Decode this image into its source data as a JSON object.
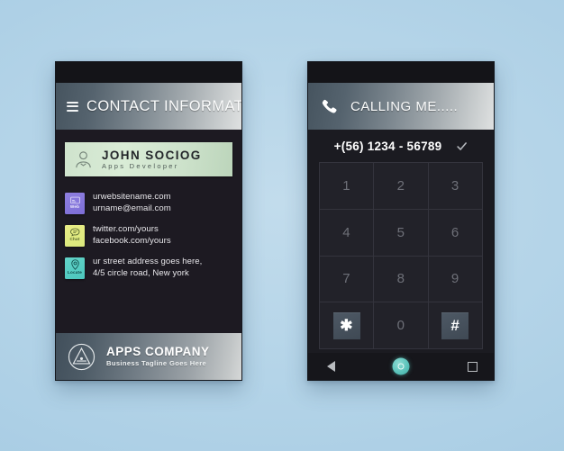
{
  "background_color": "#b4d4e8",
  "left_phone": {
    "name": "contact-information-screen",
    "header": {
      "menu_icon": "hamburger-icon",
      "title": "CONTACT INFORMATION"
    },
    "namecard": {
      "icon": "person-avatar-icon",
      "name": "JOHN SOCIOG",
      "role": "Apps Developer",
      "background_color": "#d4e8d1"
    },
    "contacts": [
      {
        "icon": "web-icon",
        "icon_caption": "Web",
        "icon_color": "#8376dc",
        "lines": [
          "urwebsitename.com",
          "urname@email.com"
        ]
      },
      {
        "icon": "chat-icon",
        "icon_caption": "Chat",
        "icon_color": "#e2ea80",
        "lines": [
          "twitter.com/yours",
          "facebook.com/yours"
        ]
      },
      {
        "icon": "locate-icon",
        "icon_caption": "Locate",
        "icon_color": "#55cbc2",
        "lines": [
          "ur street address goes here,",
          "4/5 circle road, New york"
        ]
      }
    ],
    "footer": {
      "logo_icon": "apps-company-logo-icon",
      "title": "APPS COMPANY",
      "tagline": "Business Tagline Goes Here"
    }
  },
  "right_phone": {
    "name": "dialer-calling-screen",
    "header": {
      "phone_icon": "phone-handset-icon",
      "title": "CALLING ME....."
    },
    "number_bar": {
      "number": "+(56) 1234 - 56789",
      "confirm_icon": "checkmark-icon"
    },
    "keypad": {
      "keys": [
        {
          "label": "1",
          "special": false
        },
        {
          "label": "2",
          "special": false
        },
        {
          "label": "3",
          "special": false
        },
        {
          "label": "4",
          "special": false
        },
        {
          "label": "5",
          "special": false
        },
        {
          "label": "6",
          "special": false
        },
        {
          "label": "7",
          "special": false
        },
        {
          "label": "8",
          "special": false
        },
        {
          "label": "9",
          "special": false
        },
        {
          "label": "✱",
          "special": true
        },
        {
          "label": "0",
          "special": false
        },
        {
          "label": "#",
          "special": true
        }
      ]
    },
    "navbar": {
      "back_icon": "back-triangle-icon",
      "home_icon": "home-circle-icon",
      "recents_icon": "recents-square-icon",
      "home_color": "#5cc3bb"
    }
  }
}
